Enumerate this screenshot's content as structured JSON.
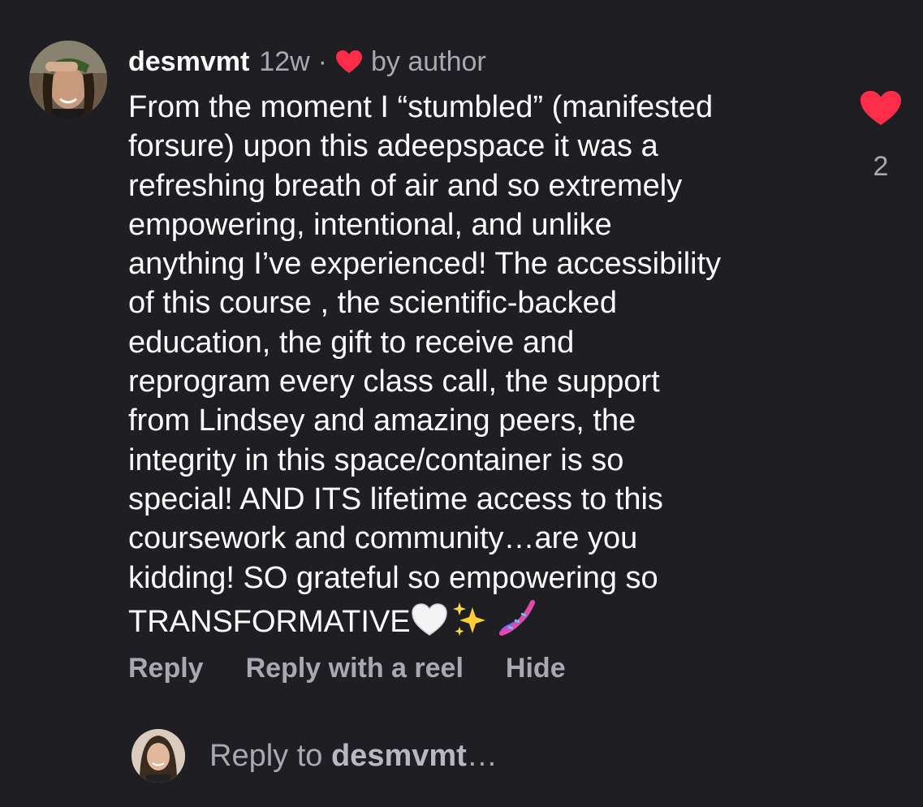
{
  "comment": {
    "username": "desmvmt",
    "age": "12w",
    "separator": "·",
    "liked_by_author_label": "by author",
    "body_lines": [
      "From the moment I “stumbled” (manifested",
      "forsure) upon this adeepspace it was a",
      "refreshing breath of air and so extremely",
      "empowering, intentional, and unlike",
      "anything I’ve experienced! The accessibility",
      "of this course , the scientific-backed",
      "education, the gift to receive and",
      "reprogram every class call, the support",
      "from Lindsey and amazing peers, the",
      "integrity in this space/container is so",
      "special! AND ITS lifetime access to this",
      "coursework and community…are you",
      "kidding! SO grateful so empowering so",
      "TRANSFORMATIVE"
    ],
    "trailing_emojis": [
      "white-heart",
      "sparkles",
      "dna"
    ],
    "like_count": "2"
  },
  "actions": {
    "reply": "Reply",
    "reply_with_reel": "Reply with a reel",
    "hide": "Hide"
  },
  "reply_bar": {
    "prefix": "Reply to ",
    "target": "desmvmt",
    "suffix": "…"
  },
  "colors": {
    "background": "#1f1f23",
    "text": "#ffffff",
    "muted": "#a8a8b0",
    "heart": "#ff2d4a"
  },
  "icons": {
    "author_heart": "heart-filled-icon",
    "like_heart": "heart-filled-icon"
  }
}
